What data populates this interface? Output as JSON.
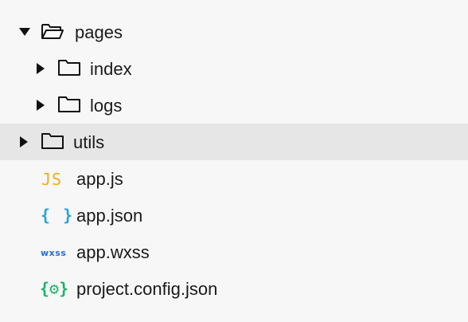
{
  "tree": {
    "folders": {
      "pages": "pages",
      "index": "index",
      "logs": "logs",
      "utils": "utils"
    },
    "files": {
      "app_js": "app.js",
      "app_json": "app.json",
      "app_wxss": "app.wxss",
      "project_config": "project.config.json"
    },
    "icons": {
      "js": "JS",
      "json": "{ }",
      "wxss": "wxss",
      "config": "{⚙}"
    },
    "colors": {
      "js": "#f0ad1e",
      "json": "#26a3e0",
      "wxss": "#2b6fd0",
      "config": "#1fb26a",
      "selected_row": "#e6e6e6"
    },
    "selected_item": "utils"
  }
}
